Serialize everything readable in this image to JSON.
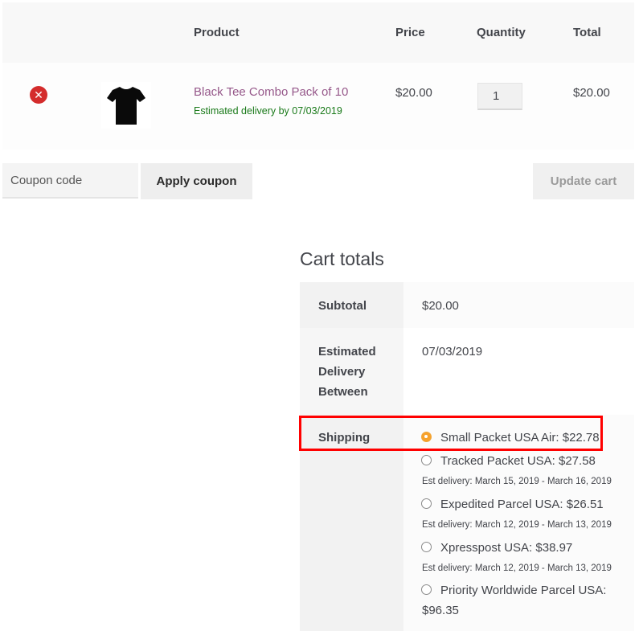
{
  "table": {
    "headers": {
      "product": "Product",
      "price": "Price",
      "quantity": "Quantity",
      "total": "Total"
    },
    "row": {
      "remove_icon": "close-x-icon",
      "thumbnail_icon": "tshirt-icon",
      "product_name": "Black Tee Combo Pack of 10",
      "delivery_note": "Estimated delivery by 07/03/2019",
      "price": "$20.00",
      "quantity": "1",
      "total": "$20.00"
    }
  },
  "coupon": {
    "placeholder": "Coupon code",
    "apply_label": "Apply coupon",
    "update_label": "Update cart"
  },
  "totals": {
    "title": "Cart totals",
    "subtotal_label": "Subtotal",
    "subtotal_value": "$20.00",
    "delivery_label": [
      "Estimated",
      "Delivery",
      "Between"
    ],
    "delivery_value": "07/03/2019",
    "shipping_label": "Shipping",
    "shipping_options": [
      {
        "label": "Small Packet USA Air: $22.78",
        "selected": true,
        "est": ""
      },
      {
        "label": "Tracked Packet USA: $27.58",
        "selected": false,
        "est": "Est delivery: March 15, 2019 - March 16, 2019"
      },
      {
        "label": "Expedited Parcel USA: $26.51",
        "selected": false,
        "est": "Est delivery: March 12, 2019 - March 13, 2019"
      },
      {
        "label": "Xpresspost USA: $38.97",
        "selected": false,
        "est": "Est delivery: March 12, 2019 - March 13, 2019"
      },
      {
        "label": "Priority Worldwide Parcel USA:",
        "label_line2": "$96.35",
        "selected": false,
        "est": ""
      }
    ]
  },
  "colors": {
    "product_link": "#96588a",
    "delivery_note": "#1a7a1a",
    "remove_icon": "#d42c2c",
    "selected_radio": "#f7a12a",
    "highlight_box": "#ff0000"
  }
}
